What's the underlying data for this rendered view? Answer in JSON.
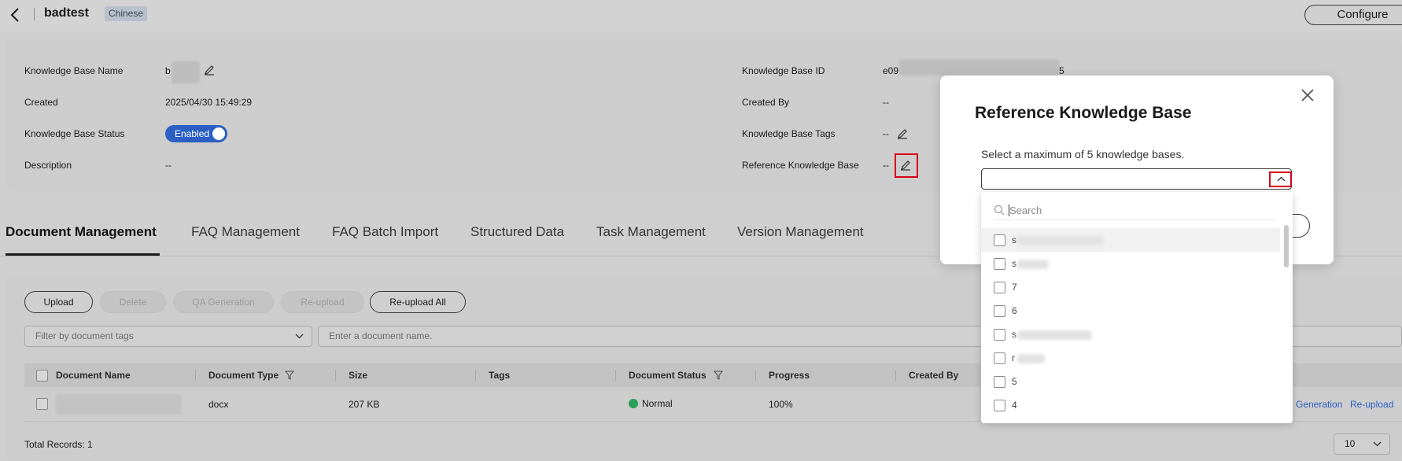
{
  "header": {
    "title": "badtest",
    "language_tag": "Chinese",
    "configure_label": "Configure"
  },
  "info": {
    "kb_name_label": "Knowledge Base Name",
    "kb_name_value": "b",
    "created_label": "Created",
    "created_value": "2025/04/30 15:49:29",
    "status_label": "Knowledge Base Status",
    "status_value": "Enabled",
    "description_label": "Description",
    "description_value": "--",
    "kb_id_label": "Knowledge Base ID",
    "kb_id_prefix": "e09",
    "kb_id_suffix": "5",
    "created_by_label": "Created By",
    "created_by_value": "--",
    "tags_label": "Knowledge Base Tags",
    "tags_value": "--",
    "ref_kb_label": "Reference Knowledge Base",
    "ref_kb_value": "--"
  },
  "tabs": [
    {
      "label": "Document Management",
      "active": true
    },
    {
      "label": "FAQ Management",
      "active": false
    },
    {
      "label": "FAQ Batch Import",
      "active": false
    },
    {
      "label": "Structured Data",
      "active": false
    },
    {
      "label": "Task Management",
      "active": false
    },
    {
      "label": "Version Management",
      "active": false
    }
  ],
  "toolbar": {
    "upload": "Upload",
    "delete": "Delete",
    "qa_generation": "QA Generation",
    "reupload": "Re-upload",
    "reupload_all": "Re-upload All",
    "tag_filter_placeholder": "Filter by document tags",
    "name_search_placeholder": "Enter a document name."
  },
  "table": {
    "columns": [
      "Document Name",
      "Document Type",
      "Size",
      "Tags",
      "Document Status",
      "Progress",
      "Created By"
    ],
    "rows": [
      {
        "type": "docx",
        "size": "207 KB",
        "tags": "",
        "status": "Normal",
        "progress": "100%",
        "action_generation": "Generation",
        "action_reupload": "Re-upload"
      }
    ],
    "total_records": "Total Records: 1",
    "page_size": "10"
  },
  "modal": {
    "title": "Reference Knowledge Base",
    "hint": "Select a maximum of 5 knowledge bases.",
    "search_placeholder": "Search",
    "options": [
      {
        "prefix": "s"
      },
      {
        "prefix": "s"
      },
      {
        "prefix": "7"
      },
      {
        "prefix": "6"
      },
      {
        "prefix": "s"
      },
      {
        "prefix": "r"
      },
      {
        "prefix": "5"
      },
      {
        "prefix": "4"
      }
    ]
  },
  "colors": {
    "primary": "#2b5fc4",
    "highlight_border": "#d9001b",
    "success": "#2aa05a"
  }
}
